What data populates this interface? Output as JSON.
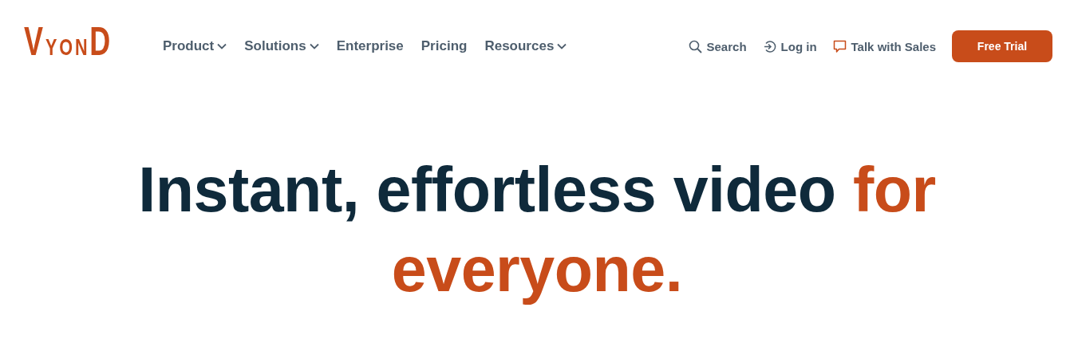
{
  "logo": "VYOND",
  "nav": [
    {
      "label": "Product",
      "dropdown": true
    },
    {
      "label": "Solutions",
      "dropdown": true
    },
    {
      "label": "Enterprise",
      "dropdown": false
    },
    {
      "label": "Pricing",
      "dropdown": false
    },
    {
      "label": "Resources",
      "dropdown": true
    }
  ],
  "actions": [
    {
      "label": "Search",
      "kind": "search"
    },
    {
      "label": "Log in",
      "kind": "login"
    },
    {
      "label": "Talk with Sales",
      "kind": "chat"
    }
  ],
  "cta": "Free Trial",
  "headline": {
    "text": "Instant, effortless video",
    "accent": "for everyone."
  }
}
